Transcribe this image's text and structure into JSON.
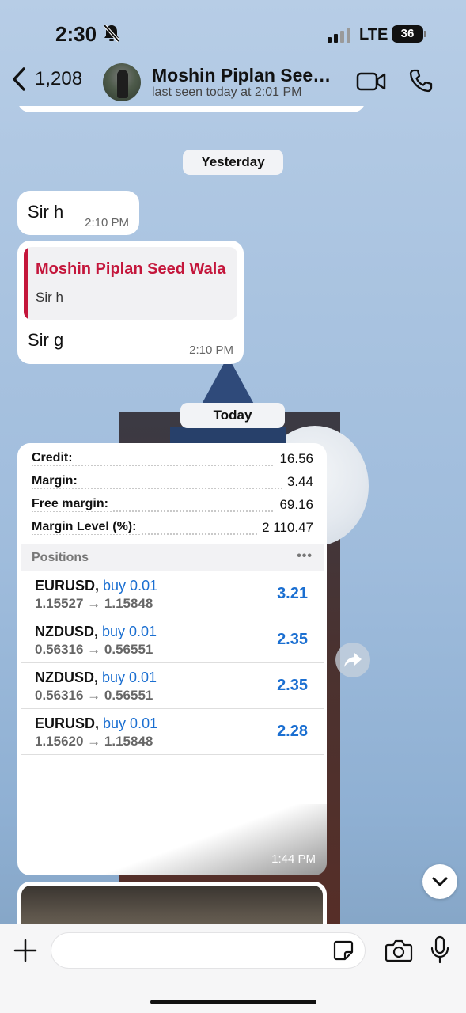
{
  "status_bar": {
    "time": "2:30",
    "network": "LTE",
    "battery": "36"
  },
  "header": {
    "back_count": "1,208",
    "contact_name": "Moshin Piplan Seed Wala",
    "last_seen": "last seen today at 2:01 PM"
  },
  "chat": {
    "date_yesterday": "Yesterday",
    "date_today": "Today",
    "messages": [
      {
        "text": "Sir h",
        "time": "2:10 PM"
      },
      {
        "reply_author": "Moshin Piplan Seed Wala",
        "reply_text": "Sir h",
        "text": "Sir g",
        "time": "2:10 PM"
      }
    ],
    "screenshot": {
      "time": "1:44 PM",
      "account": [
        {
          "label": "Credit:",
          "value": "16.56"
        },
        {
          "label": "Margin:",
          "value": "3.44"
        },
        {
          "label": "Free margin:",
          "value": "69.16"
        },
        {
          "label": "Margin Level (%):",
          "value": "2 110.47"
        }
      ],
      "positions_label": "Positions",
      "positions_more": "•••",
      "positions": [
        {
          "symbol": "EURUSD,",
          "side": "buy 0.01",
          "prices": "1.15527 → 1.15848",
          "profit": "3.21"
        },
        {
          "symbol": "NZDUSD,",
          "side": "buy 0.01",
          "prices": "0.56316 → 0.56551",
          "profit": "2.35"
        },
        {
          "symbol": "NZDUSD,",
          "side": "buy 0.01",
          "prices": "0.56316 → 0.56551",
          "profit": "2.35"
        },
        {
          "symbol": "EURUSD,",
          "side": "buy 0.01",
          "prices": "1.15620 → 1.15848",
          "profit": "2.28"
        }
      ]
    }
  },
  "input": {
    "placeholder": ""
  },
  "colors": {
    "reply_accent": "#c4163b",
    "trade_blue": "#1b6fd1"
  },
  "icons": [
    "bell-off-icon",
    "signal-icon",
    "battery-icon",
    "back-chevron-icon",
    "video-icon",
    "phone-icon",
    "forward-icon",
    "chevron-down-icon",
    "plus-icon",
    "sticker-icon",
    "camera-icon",
    "mic-icon"
  ]
}
